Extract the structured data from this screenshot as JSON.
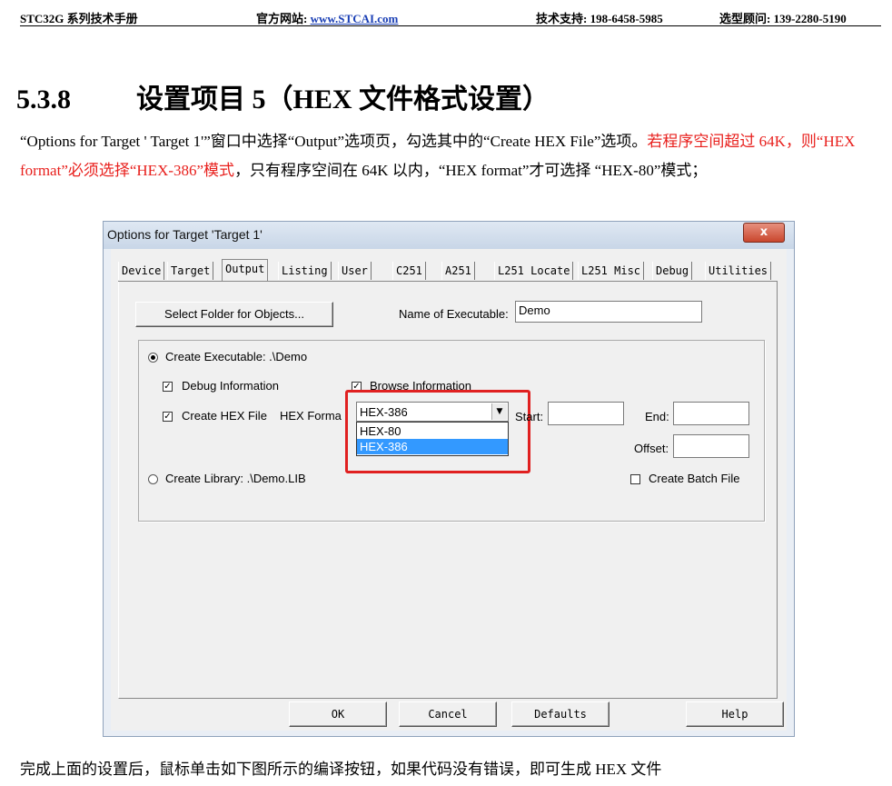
{
  "header": {
    "manual": "STC32G 系列技术手册",
    "site_label": "官方网站: ",
    "site_url": "www.STCAI.com",
    "support": "技术支持: 198-6458-5985",
    "consult": "选型顾问: 139-2280-5190"
  },
  "section": {
    "number": "5.3.8",
    "title": "设置项目 5（HEX 文件格式设置）"
  },
  "paragraph": {
    "part1": "“Options for Target ' Target 1'”窗口中选择“Output”选项页，勾选其中的“Create HEX File”选项。",
    "part2_red": "若程序空间超过 64K，则“HEX format”必须选择“HEX-386”模式",
    "part3": "，只有程序空间在 64K 以内，“HEX format”才可选择 “HEX-80”模式；"
  },
  "dialog": {
    "title": "Options for Target 'Target 1'",
    "close_glyph": "x",
    "tabs": [
      "Device",
      "Target",
      "Output",
      "Listing",
      "User",
      "C251",
      "A251",
      "L251 Locate",
      "L251 Misc",
      "Debug",
      "Utilities"
    ],
    "active_tab": "Output",
    "select_folder_label": "Select Folder for Objects...",
    "name_exe_label": "Name of Executable:",
    "name_exe_value": "Demo",
    "create_exe_label": "Create Executable:  .\\Demo",
    "create_exe_selected": true,
    "debug_info_label": "Debug Information",
    "debug_info_checked": true,
    "browse_info_label": "Browse Information",
    "browse_info_checked": true,
    "create_hex_label": "Create HEX File",
    "create_hex_checked": true,
    "hex_format_label": "HEX Forma",
    "hex_format_value": "HEX-386",
    "hex_options": [
      "HEX-80",
      "HEX-386"
    ],
    "hex_highlighted": "HEX-386",
    "start_label": "Start:",
    "end_label": "End:",
    "offset_label": "Offset:",
    "create_lib_label": "Create Library:  .\\Demo.LIB",
    "create_lib_selected": false,
    "create_batch_label": "Create Batch File",
    "create_batch_checked": false,
    "buttons": {
      "ok": "OK",
      "cancel": "Cancel",
      "defaults": "Defaults",
      "help": "Help"
    },
    "check_glyph": "✓"
  },
  "footer_text": "完成上面的设置后，鼠标单击如下图所示的编译按钮，如果代码没有错误，即可生成 HEX 文件",
  "colors": {
    "red_text": "#e8201d",
    "highlight": "#3399ff",
    "link": "#1a3fb5",
    "annotation_box": "#e02020"
  }
}
